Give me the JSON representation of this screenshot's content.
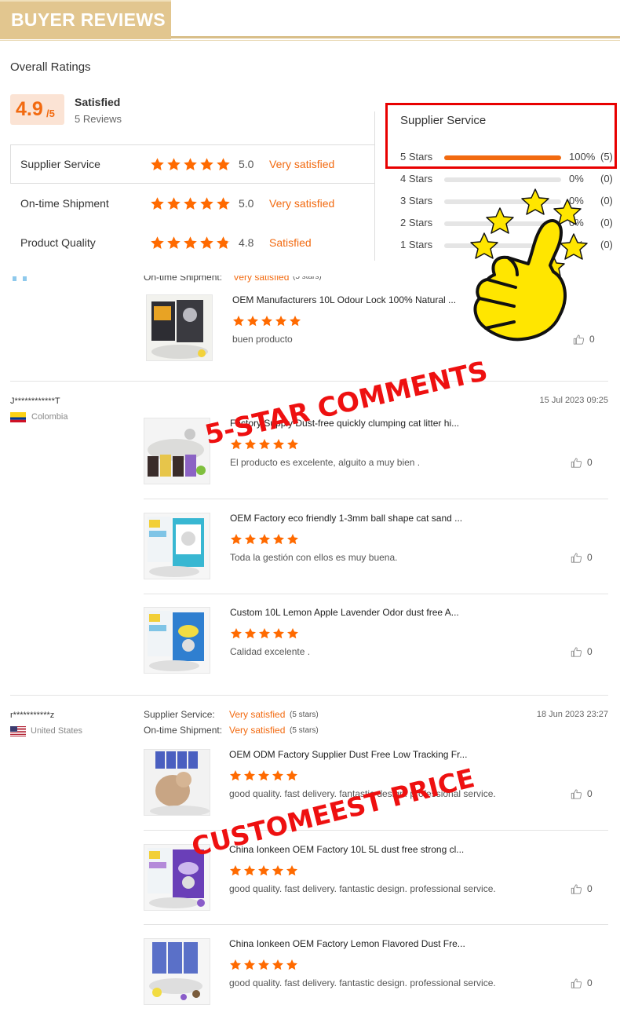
{
  "header": {
    "title": "BUYER REVIEWS"
  },
  "overall": {
    "title": "Overall Ratings",
    "score": "4.9",
    "score_den": "/5",
    "satisfaction": "Satisfied",
    "review_count": "5 Reviews"
  },
  "ratings": [
    {
      "label": "Supplier Service",
      "value": "5.0",
      "satisfaction": "Very satisfied",
      "stars": 5
    },
    {
      "label": "On-time Shipment",
      "value": "5.0",
      "satisfaction": "Very satisfied",
      "stars": 5
    },
    {
      "label": "Product Quality",
      "value": "4.8",
      "satisfaction": "Satisfied",
      "stars": 4.8
    }
  ],
  "breakdown": {
    "title": "Supplier Service",
    "rows": [
      {
        "label": "5 Stars",
        "pct": "100%",
        "count": "(5)",
        "fill": 1.0
      },
      {
        "label": "4 Stars",
        "pct": "0%",
        "count": "(0)",
        "fill": 0
      },
      {
        "label": "3 Stars",
        "pct": "0%",
        "count": "(0)",
        "fill": 0
      },
      {
        "label": "2 Stars",
        "pct": "0%",
        "count": "(0)",
        "fill": 0
      },
      {
        "label": "1 Stars",
        "pct": "0%",
        "count": "(0)",
        "fill": 0
      }
    ]
  },
  "review0": {
    "partial_meta_label": "On-time Shipment:",
    "partial_meta_sat": "Very satisfied",
    "partial_meta_stars": "(5 stars)",
    "products": [
      {
        "name": "OEM Manufacturers 10L Odour Lock 100% Natural ...",
        "comment": "buen producto",
        "likes": "0"
      }
    ]
  },
  "review1": {
    "user": "J************T",
    "country": "Colombia",
    "date": "15 Jul 2023 09:25",
    "products": [
      {
        "name": "Factory Supply Dust-free quickly clumping cat litter hi...",
        "comment": "El producto es excelente, alguito a muy bien .",
        "likes": "0"
      },
      {
        "name": "OEM Factory eco friendly 1-3mm ball shape cat sand ...",
        "comment": "Toda la gestión con ellos es muy buena.",
        "likes": "0"
      },
      {
        "name": "Custom 10L Lemon Apple Lavender Odor dust free A...",
        "comment": "Calidad excelente .",
        "likes": "0"
      }
    ]
  },
  "review2": {
    "user": "r***********z",
    "country": "United States",
    "date": "18 Jun 2023 23:27",
    "meta": [
      {
        "label": "Supplier Service:",
        "sat": "Very satisfied",
        "stars": "(5 stars)"
      },
      {
        "label": "On-time Shipment:",
        "sat": "Very satisfied",
        "stars": "(5 stars)"
      }
    ],
    "products": [
      {
        "name": "OEM ODM Factory Supplier Dust Free Low Tracking Fr...",
        "comment": "good quality. fast delivery. fantastic design. professional service.",
        "likes": "0"
      },
      {
        "name": "China Ionkeen OEM Factory 10L 5L dust free strong cl...",
        "comment": "good quality. fast delivery. fantastic design. professional service.",
        "likes": "0"
      },
      {
        "name": "China Ionkeen OEM Factory Lemon Flavored Dust Fre...",
        "comment": "good quality. fast delivery. fantastic design. professional service.",
        "likes": "0"
      }
    ]
  },
  "overlays": {
    "comments": "5-STAR COMMENTS",
    "price": "CUSTOMEEST PRICE"
  },
  "colors": {
    "accent": "#f26a10",
    "header_gold": "#e2c68f",
    "highlight": "#e80000",
    "star": "#ff6a00"
  }
}
